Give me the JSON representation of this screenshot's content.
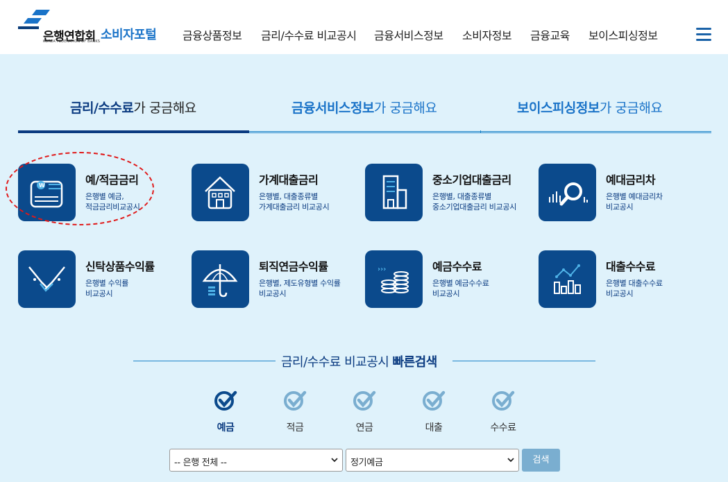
{
  "header": {
    "logo_text": "은행연합회",
    "logo_portal": "소비자포털",
    "logo_sub": "KOREA FEDERATION OF BANKS",
    "nav": [
      "금융상품정보",
      "금리/수수료 비교공시",
      "금융서비스정보",
      "소비자정보",
      "금융교육",
      "보이스피싱정보"
    ],
    "menu_icon": "hamburger-icon"
  },
  "tabs": [
    {
      "strong": "금리/수수료",
      "rest": "가 궁금해요"
    },
    {
      "strong": "금융서비스정보",
      "rest": "가 궁금해요"
    },
    {
      "strong": "보이스피싱정보",
      "rest": "가 궁금해요"
    }
  ],
  "cards": [
    {
      "title": "예/적금금리",
      "desc": "은행별 예금,\n적금금리비교공시",
      "icon": "deposit-icon"
    },
    {
      "title": "가계대출금리",
      "desc": "은행별, 대출종류별\n가계대출금리 비교공시",
      "icon": "house-icon"
    },
    {
      "title": "중소기업대출금리",
      "desc": "은행별, 대출종류별\n중소기업대출금리 비교공시",
      "icon": "building-icon"
    },
    {
      "title": "예대금리차",
      "desc": "은행별 예대금리차\n비교공시",
      "icon": "magnifier-chart-icon"
    },
    {
      "title": "신탁상품수익률",
      "desc": "은행별 수익률\n비교공시",
      "icon": "handshake-icon"
    },
    {
      "title": "퇴직연금수익률",
      "desc": "은행별, 제도유형별 수익률\n비교공시",
      "icon": "umbrella-icon"
    },
    {
      "title": "예금수수료",
      "desc": "은행별 예금수수료\n비교공시",
      "icon": "coins-icon"
    },
    {
      "title": "대출수수료",
      "desc": "은행별 대출수수료\n비교공시",
      "icon": "bar-chart-icon"
    }
  ],
  "quick_search": {
    "title_plain": "금리/수수료 비교공시 ",
    "title_strong": "빠른검색",
    "items": [
      "예금",
      "적금",
      "연금",
      "대출",
      "수수료"
    ],
    "active_index": 0,
    "bank_select": "-- 은행 전체 --",
    "product_select": "정기예금",
    "search_button": "검색"
  },
  "colors": {
    "background": "#dff2fb",
    "navy": "#0b4a8c",
    "accent": "#1a73c8",
    "highlight_circle": "#e01818"
  }
}
